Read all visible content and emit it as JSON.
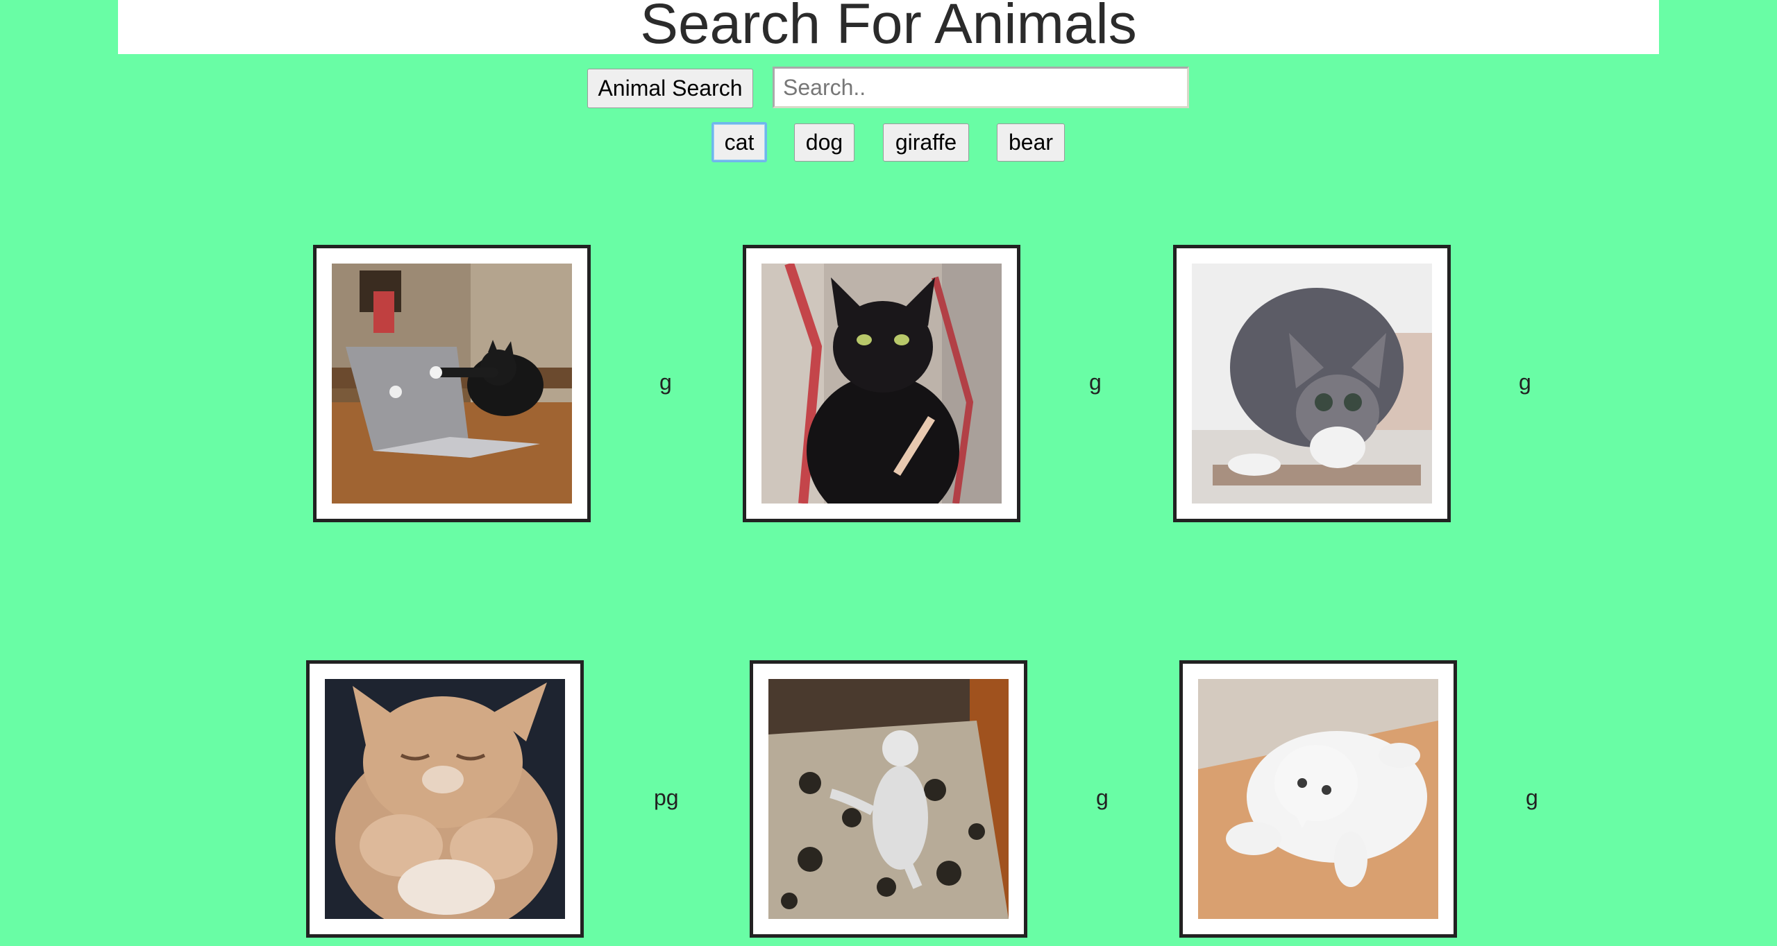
{
  "header": {
    "title": "Search For Animals"
  },
  "search": {
    "button_label": "Animal Search",
    "placeholder": "Search.."
  },
  "animals": [
    "cat",
    "dog",
    "giraffe",
    "bear"
  ],
  "selected_animal": "cat",
  "results": [
    {
      "subject": "cat typing on laptop",
      "suffix": "g"
    },
    {
      "subject": "black cat with nail file",
      "suffix": "g"
    },
    {
      "subject": "tabby cat crouching",
      "suffix": "g"
    },
    {
      "subject": "orange kitten",
      "suffix": "pg"
    },
    {
      "subject": "white cat standing on rug",
      "suffix": "g"
    },
    {
      "subject": "white cat lying upside down",
      "suffix": "g"
    }
  ],
  "colors": {
    "background": "#69fda5",
    "header_bg": "#ffffff",
    "card_border": "#222222",
    "focus_ring": "#6fb7ec"
  }
}
